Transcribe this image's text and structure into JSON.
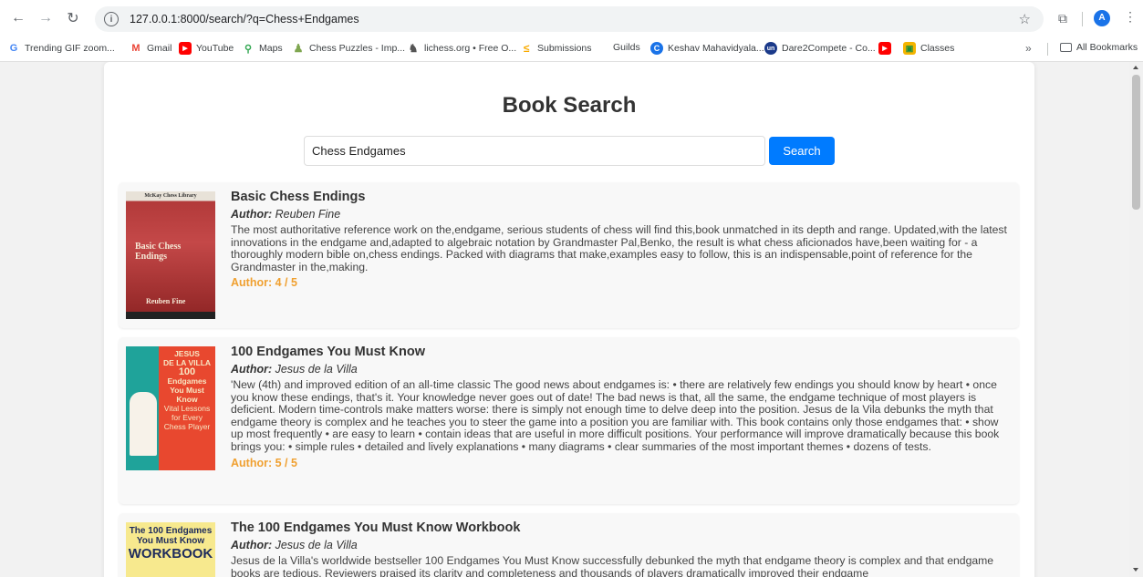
{
  "browser": {
    "url": "127.0.0.1:8000/search/?q=Chess+Endgames",
    "profile_initial": "A",
    "bookmarks": [
      {
        "label": "Trending GIF zoom...",
        "icon": "G",
        "color": "#4285f4"
      },
      {
        "label": "Gmail",
        "icon": "M",
        "color": "#ea4335"
      },
      {
        "label": "YouTube",
        "icon": "▶",
        "color": "#ff0000"
      },
      {
        "label": "Maps",
        "icon": "⚲",
        "color": "#34a853"
      },
      {
        "label": "Chess Puzzles - Imp...",
        "icon": "♟",
        "color": "#7fa650"
      },
      {
        "label": "lichess.org • Free O...",
        "icon": "♞",
        "color": "#555555"
      },
      {
        "label": "Submissions",
        "icon": "≤",
        "color": "#f9ab00"
      },
      {
        "label": "Guilds",
        "icon": "",
        "color": "#ffffff"
      },
      {
        "label": "Keshav Mahavidyala...",
        "icon": "C",
        "color": "#1a73e8"
      },
      {
        "label": "Dare2Compete - Co...",
        "icon": "un",
        "color": "#1b3a8a"
      },
      {
        "label": "",
        "icon": "▶",
        "color": "#ff0000"
      },
      {
        "label": "Classes",
        "icon": "▣",
        "color": "#f4b400"
      }
    ],
    "all_bookmarks": "All Bookmarks",
    "more": "»"
  },
  "page": {
    "title": "Book Search",
    "search_value": "Chess Endgames",
    "search_button": "Search",
    "author_prefix": "Author:"
  },
  "books": [
    {
      "title": "Basic Chess Endings",
      "author": "Reuben Fine",
      "description": "The most authoritative reference work on the,endgame, serious students of chess will find this,book unmatched in its depth and range. Updated,with the latest innovations in the endgame and,adapted to algebraic notation by Grandmaster Pal,Benko, the result is what chess aficionados have,been waiting for - a thoroughly modern bible on,chess endings. Packed with diagrams that make,examples easy to follow, this is an indispensable,point of reference for the Grandmaster in the,making.",
      "rating": "Author: 4 / 5",
      "cover": {
        "top": "McKay Chess Library",
        "line1": "Basic Chess",
        "line2": "Endings",
        "author": "Reuben Fine"
      }
    },
    {
      "title": "100 Endgames You Must Know",
      "author": "Jesus de la Villa",
      "description": "'New (4th) and improved edition of an all-time classic The good news about endgames is: • there are relatively few endings you should know by heart • once you know these endings, that's it. Your knowledge never goes out of date! The bad news is that, all the same, the endgame technique of most players is deficient. Modern time-controls make matters worse: there is simply not enough time to delve deep into the position. Jesus de la Vila debunks the myth that endgame theory is complex and he teaches you to steer the game into a position you are familiar with. This book contains only those endgames that: • show up most frequently • are easy to learn • contain ideas that are useful in more difficult positions. Your performance will improve dramatically because this book brings you: • simple rules • detailed and lively explanations • many diagrams • clear summaries of the most important themes • dozens of tests.",
      "rating": "Author: 5 / 5",
      "cover": {
        "l1": "JESUS",
        "l2": "DE LA VILLA",
        "l3": "100",
        "l4": "Endgames",
        "l5": "You Must",
        "l6": "Know",
        "l7": "Vital Lessons",
        "l8": "for Every",
        "l9": "Chess Player"
      }
    },
    {
      "title": "The 100 Endgames You Must Know Workbook",
      "author": "Jesus de la Villa",
      "description": "Jesus de la Villa's worldwide bestseller 100 Endgames You Must Know successfully debunked the myth that endgame theory is complex and that endgame books are tedious. Reviewers praised its clarity and completeness and thousands of players dramatically improved their endgame",
      "cover": {
        "l1": "The 100 Endgames",
        "l2": "You Must Know",
        "l3": "WORKBOOK"
      }
    }
  ]
}
